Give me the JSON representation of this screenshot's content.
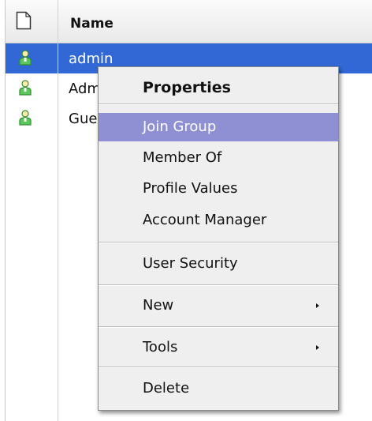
{
  "table": {
    "column_name": "Name",
    "rows": [
      {
        "name": "admin",
        "selected": true
      },
      {
        "name": "Adm",
        "selected": false
      },
      {
        "name": "Gue",
        "selected": false
      }
    ]
  },
  "context_menu": {
    "title": "Properties",
    "items": {
      "join_group": "Join Group",
      "member_of": "Member Of",
      "profile_values": "Profile Values",
      "account_manager": "Account Manager",
      "user_security": "User Security",
      "new": "New",
      "tools": "Tools",
      "delete": "Delete"
    },
    "hovered_item": "Join Group"
  },
  "colors": {
    "selection": "#3168d5",
    "menu_hover": "#8f8fd4",
    "menu_background": "#efefef",
    "user_icon": "#3aaa3a"
  },
  "icons": {
    "header": "document-icon",
    "row": "user-icon",
    "submenu": "submenu-arrow-icon"
  }
}
